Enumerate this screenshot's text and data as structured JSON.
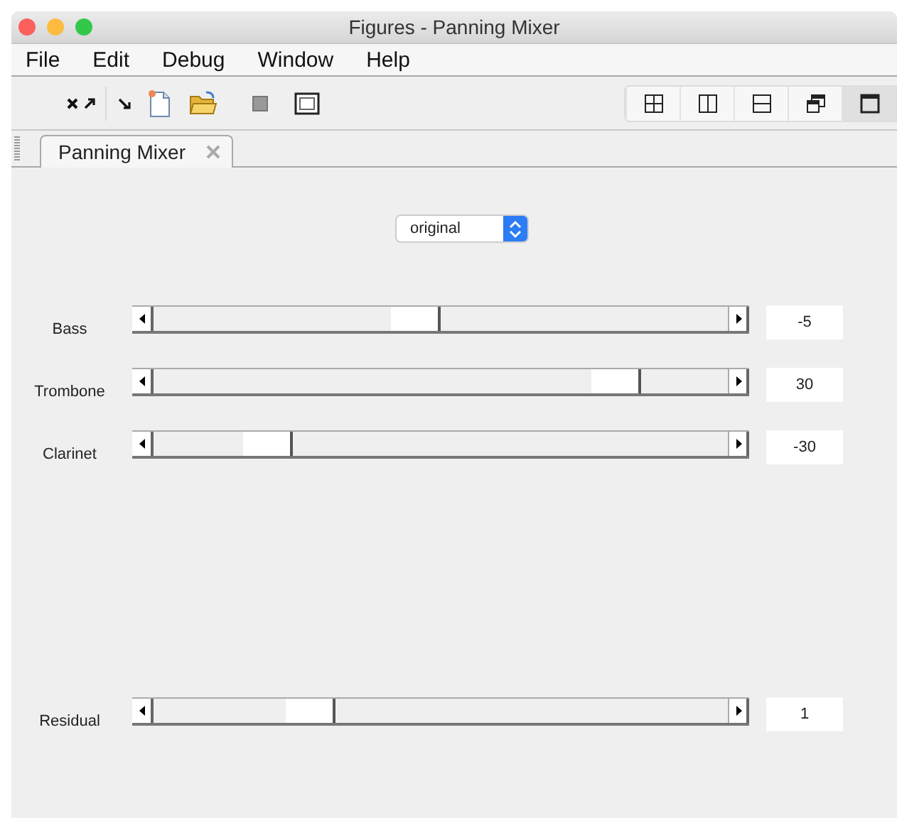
{
  "window": {
    "title": "Figures - Panning Mixer"
  },
  "menu": [
    "File",
    "Edit",
    "Debug",
    "Window",
    "Help"
  ],
  "layout_buttons": [
    {
      "kind": "grid",
      "selected": false
    },
    {
      "kind": "columns",
      "selected": false
    },
    {
      "kind": "rows",
      "selected": false
    },
    {
      "kind": "float",
      "selected": false
    },
    {
      "kind": "single",
      "selected": true
    }
  ],
  "tabs": [
    {
      "label": "Panning Mixer",
      "selected": true
    }
  ],
  "dropdown": {
    "value": "original"
  },
  "channels": [
    {
      "name": "Bass",
      "level": 0.45,
      "reading": "-5"
    },
    {
      "name": "Trombone",
      "level": 0.83,
      "reading": "30"
    },
    {
      "name": "Clarinet",
      "level": 0.17,
      "reading": "-30"
    }
  ],
  "residual": {
    "name": "Residual",
    "level": 0.25,
    "reading": "1"
  }
}
